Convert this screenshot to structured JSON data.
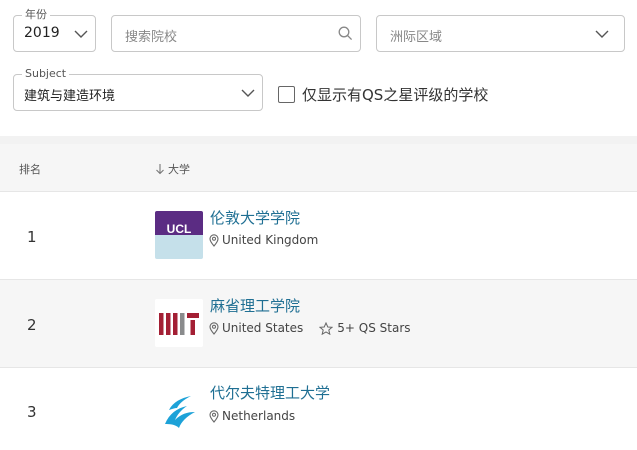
{
  "filters": {
    "year": {
      "legend": "年份",
      "value": "2019"
    },
    "search": {
      "placeholder": "搜索院校"
    },
    "region": {
      "placeholder": "洲际区域"
    },
    "subject": {
      "legend": "Subject",
      "value": "建筑与建造环境"
    },
    "qs_stars_only": {
      "label": "仅显示有QS之星评级的学校",
      "checked": false
    }
  },
  "table": {
    "headers": {
      "rank": "排名",
      "university": "大学"
    },
    "rows": [
      {
        "rank": "1",
        "name": "伦敦大学学院",
        "country": "United Kingdom",
        "logo_text": "UCL"
      },
      {
        "rank": "2",
        "name": "麻省理工学院",
        "country": "United States",
        "stars": "5+ QS Stars",
        "logo_text": "MIT"
      },
      {
        "rank": "3",
        "name": "代尔夫特理工大学",
        "country": "Netherlands"
      }
    ]
  },
  "colors": {
    "link": "#1f6f93",
    "ucl_purple": "#5b2c83",
    "ucl_light": "#c5e0ea",
    "mit_red": "#a31f34"
  },
  "icons": [
    "chevron-down-icon",
    "search-icon",
    "location-pin-icon",
    "star-icon",
    "sort-arrow-down-icon"
  ]
}
